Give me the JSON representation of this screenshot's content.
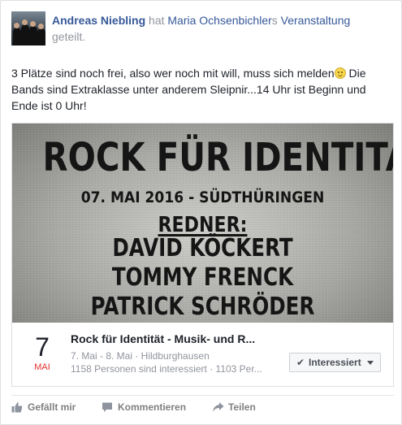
{
  "post": {
    "author": "Andreas Niebling",
    "shared_verb": " hat ",
    "owner": "Maria Ochsenbichler",
    "owner_suffix": "s ",
    "object": "Veranstaltung",
    "shared_tail": "geteilt.",
    "message_part1": "3 Plätze sind noch frei, also wer noch mit will, muss sich melden",
    "message_part2": " Die Bands sind Extraklasse unter anderem Sleipnir...14 Uhr ist Beginn und Ende ist 0 Uhr!"
  },
  "banner": {
    "title": "ROCK FÜR IDENTITÄT",
    "date_place": "07. MAI 2016 - SÜDTHÜRINGEN",
    "redner": "REDNER:",
    "speakers": [
      "DAVID KÖCKERT",
      "TOMMY FRENCK",
      "PATRICK SCHRÖDER"
    ]
  },
  "event": {
    "day": "7",
    "month": "MAI",
    "title": "Rock für Identität - Musik- und R...",
    "dates_place": "7. Mai - 8. Mai · Hildburghausen",
    "stats": "1158 Personen sind interessiert · 1103 Per...",
    "interest_label": "Interessiert"
  },
  "actions": {
    "like": "Gefällt mir",
    "comment": "Kommentieren",
    "share": "Teilen"
  },
  "icons": {
    "avatar": "profile-photo",
    "smiley": "smiley-emoji-icon",
    "check": "check-icon",
    "caret": "chevron-down-icon",
    "like": "thumbs-up-icon",
    "comment": "comment-icon",
    "share": "share-arrow-icon"
  },
  "colors": {
    "link": "#365899",
    "month": "#e62e2e",
    "secondary": "#90949c"
  }
}
